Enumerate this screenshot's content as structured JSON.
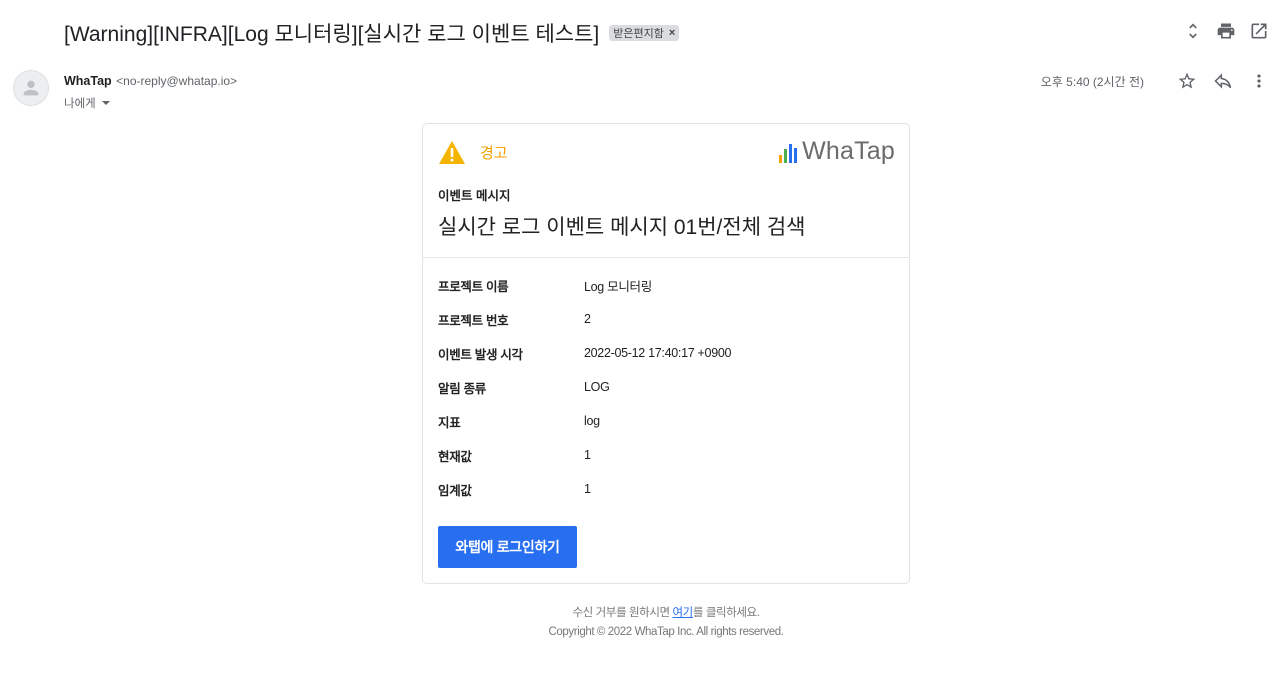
{
  "email": {
    "subject": "[Warning][INFRA][Log 모니터링][실시간 로그 이벤트 테스트]",
    "label_chip": "받은편지함",
    "label_remove": "×",
    "sender": {
      "name": "WhaTap",
      "email": "<no-reply@whatap.io>",
      "recipient": "나에게"
    },
    "time": "오후 5:40 (2시간 전)"
  },
  "icons": {
    "expand": "unfold-icon",
    "print": "print-icon",
    "popout": "open-in-new-icon",
    "star": "star-icon",
    "reply": "reply-icon",
    "more": "more-vert-icon",
    "avatar": "person-icon",
    "warning": "warning-icon"
  },
  "card": {
    "warning_text": "경고",
    "logo_text": "WhaTap",
    "event_label": "이벤트 메시지",
    "event_title": "실시간 로그 이벤트 메시지 01번/전체 검색",
    "rows": [
      {
        "key": "프로젝트 이름",
        "value": "Log 모니터링"
      },
      {
        "key": "프로젝트 번호",
        "value": "2"
      },
      {
        "key": "이벤트 발생 시각",
        "value": "2022-05-12 17:40:17 +0900"
      },
      {
        "key": "알림 종류",
        "value": "LOG"
      },
      {
        "key": "지표",
        "value": "log"
      },
      {
        "key": "현재값",
        "value": "1"
      },
      {
        "key": "임계값",
        "value": "1"
      }
    ],
    "login_button": "와탭에 로그인하기"
  },
  "footer": {
    "unsub_prefix": "수신 거부를 원하시면 ",
    "unsub_link": "여기",
    "unsub_suffix": "를 클릭하세요.",
    "copyright": "Copyright © 2022 WhaTap Inc. All rights reserved."
  },
  "colors": {
    "warning": "#f4a000",
    "button": "#276ef1",
    "logo_bars": [
      "#f4a000",
      "#4caf50",
      "#276ef1",
      "#276ef1"
    ]
  }
}
